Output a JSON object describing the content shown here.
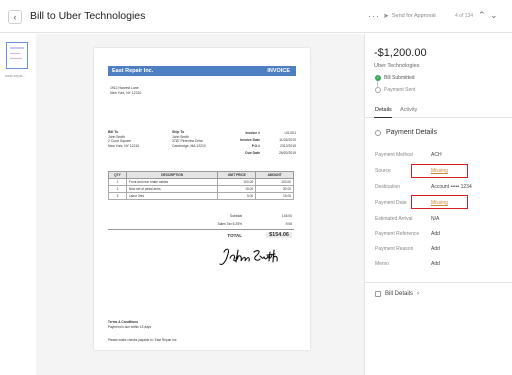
{
  "header": {
    "back_icon": "chevron-left-icon",
    "title": "Bill to Uber Technologies",
    "more_label": "···",
    "send_label": "Send for Approval",
    "pager": "4 of 134"
  },
  "thumbnails": [
    {
      "label": "east-repa..."
    }
  ],
  "invoice": {
    "company": "East Repair Inc.",
    "doc_type": "INVOICE",
    "company_address": [
      "1912 Harvest Lane",
      "New York, NY 12210"
    ],
    "bill_to_label": "Bill To",
    "bill_to": [
      "John Smith",
      "2 Court Square",
      "New York, NY 12210"
    ],
    "ship_to_label": "Ship To",
    "ship_to": [
      "John Smith",
      "3787 Pineview Drive",
      "Cambridge, MA 12210"
    ],
    "meta": [
      {
        "k": "Invoice #",
        "v": "US-001"
      },
      {
        "k": "Invoice Date",
        "v": "11/02/2019"
      },
      {
        "k": "P.O.#",
        "v": "2312/2019"
      },
      {
        "k": "Due Date",
        "v": "26/02/2019"
      }
    ],
    "columns": [
      "QTY",
      "DESCRIPTION",
      "UNIT PRICE",
      "AMOUNT"
    ],
    "rows": [
      [
        "1",
        "Front and rear brake cables",
        "100.00",
        "100.00"
      ],
      [
        "2",
        "New set of pedal arms",
        "15.00",
        "30.00"
      ],
      [
        "3",
        "Labor 3hrs",
        "5.00",
        "15.00"
      ]
    ],
    "subtotal_label": "Subtotal",
    "subtotal": "145.00",
    "tax_label": "Sales Tax 6.25%",
    "tax": "9.06",
    "total_label": "TOTAL",
    "total": "$154.06",
    "signature": "John Smith",
    "terms_title": "Terms & Conditions",
    "terms_text": "Payment is due within 15 days",
    "pay_note": "Please make checks payable to: East Repair Inc."
  },
  "panel": {
    "amount": "-$1,200.00",
    "vendor": "Uber Technologies",
    "statuses": [
      "Bill Submitted",
      "Payment Sent"
    ],
    "tabs": [
      "Details",
      "Activity"
    ],
    "section_title": "Payment Details",
    "fields": [
      {
        "k": "Payment Method",
        "v": "ACH"
      },
      {
        "k": "Source",
        "v": "Missing"
      },
      {
        "k": "Destination",
        "v": "Account ••••• 1234"
      },
      {
        "k": "Payment Date",
        "v": "Missing"
      },
      {
        "k": "Estimated Arrival",
        "v": "N/A"
      },
      {
        "k": "Payment Reference",
        "v": "Add"
      },
      {
        "k": "Payment Reason",
        "v": "Add"
      },
      {
        "k": "Memo",
        "v": "Add"
      }
    ],
    "bill_details_label": "Bill Details",
    "chevron": "›"
  }
}
